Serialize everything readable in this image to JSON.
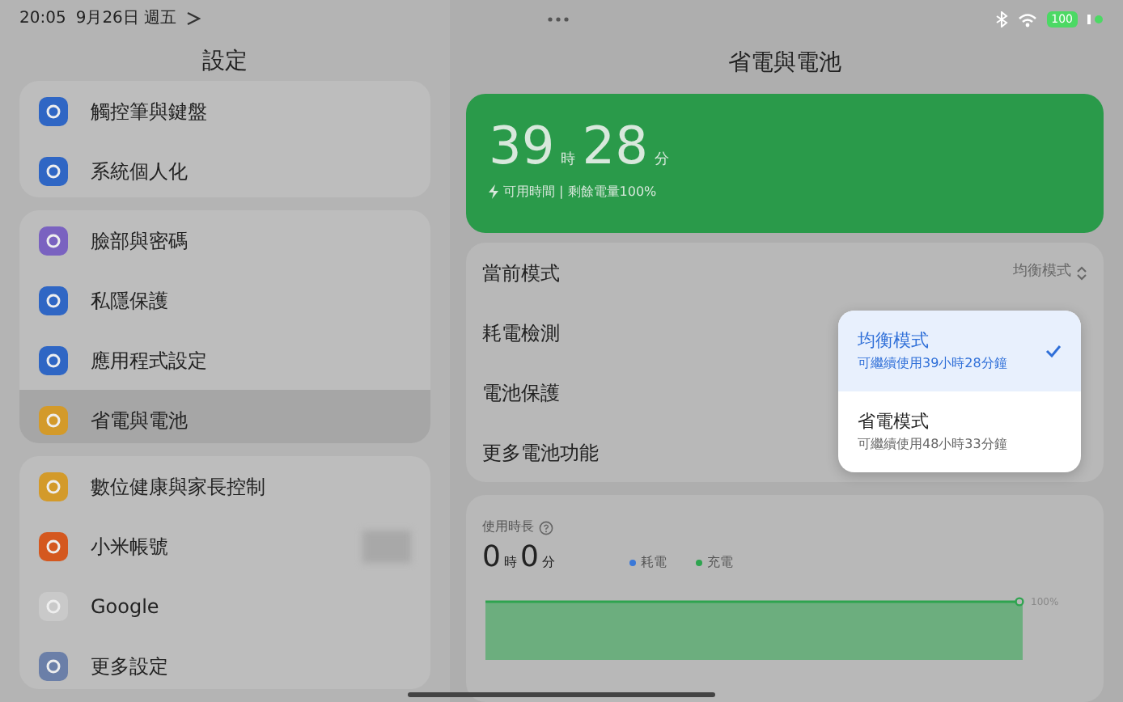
{
  "status_bar": {
    "time": "20:05",
    "date": "9月26日 週五",
    "battery": "100"
  },
  "sidebar": {
    "title": "設定",
    "groups": [
      {
        "items": [
          {
            "label": "觸控筆與鍵盤",
            "color": "#2f66c4",
            "selected": false
          },
          {
            "label": "系統個人化",
            "color": "#2f66c4",
            "selected": false
          }
        ]
      },
      {
        "items": [
          {
            "label": "臉部與密碼",
            "color": "#7a62c0",
            "selected": false
          },
          {
            "label": "私隱保護",
            "color": "#2f66c4",
            "selected": false
          },
          {
            "label": "應用程式設定",
            "color": "#2f66c4",
            "selected": false
          },
          {
            "label": "省電與電池",
            "color": "#d39a2a",
            "selected": true
          }
        ]
      },
      {
        "items": [
          {
            "label": "數位健康與家長控制",
            "color": "#d39a2a",
            "selected": false
          },
          {
            "label": "小米帳號",
            "color": "#d4581f",
            "selected": false
          },
          {
            "label": "Google",
            "color": "#c9c9c9",
            "selected": false
          },
          {
            "label": "更多設定",
            "color": "#6b7fa8",
            "selected": false
          }
        ]
      }
    ]
  },
  "main": {
    "title": "省電與電池",
    "battery_card": {
      "hours": "39",
      "hours_unit": "時",
      "minutes": "28",
      "minutes_unit": "分",
      "caption": "可用時間 | 剩餘電量100%"
    },
    "settings": [
      {
        "label": "當前模式",
        "value": "均衡模式"
      },
      {
        "label": "耗電檢測"
      },
      {
        "label": "電池保護"
      },
      {
        "label": "更多電池功能"
      }
    ],
    "mode_menu": {
      "options": [
        {
          "title": "均衡模式",
          "subtitle": "可繼續使用39小時28分鐘",
          "selected": true
        },
        {
          "title": "省電模式",
          "subtitle": "可繼續使用48小時33分鐘",
          "selected": false
        }
      ]
    },
    "usage": {
      "title": "使用時長",
      "hours": "0",
      "hours_unit": "時",
      "minutes": "0",
      "minutes_unit": "分",
      "legend": [
        {
          "label": "耗電",
          "color": "#3a78d8"
        },
        {
          "label": "充電",
          "color": "#2ea44f"
        }
      ],
      "axis_label": "100%"
    }
  }
}
